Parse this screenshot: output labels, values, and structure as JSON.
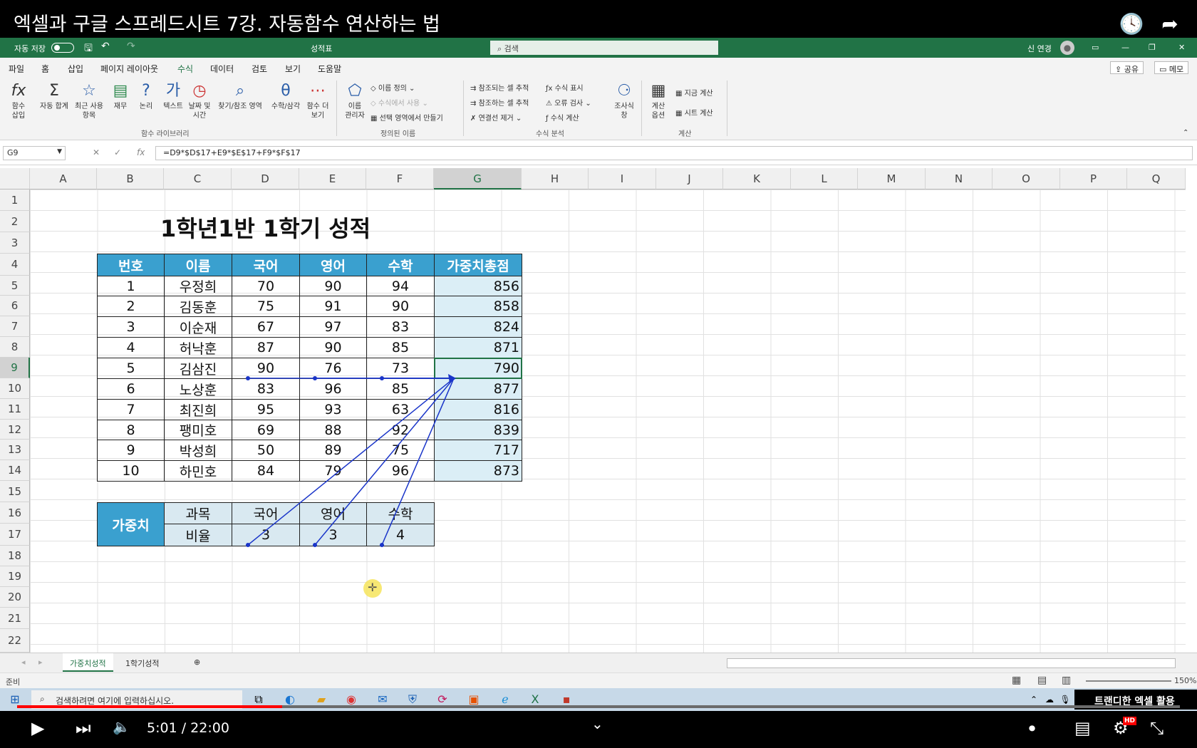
{
  "video": {
    "title": "엑셀과 구글 스프레드시트 7강. 자동함수 연산하는 법",
    "time": "5:01 / 22:00",
    "progress_pct": 22.8,
    "channel_overlay": "트랜디한 엑셀 활용",
    "hd_badge": "HD"
  },
  "titlebar": {
    "autosave": "자동 저장",
    "file_name": "성적표",
    "search_placeholder": "검색",
    "user": "신 연경"
  },
  "tabs": [
    "파일",
    "홈",
    "삽입",
    "페이지 레이아웃",
    "수식",
    "데이터",
    "검토",
    "보기",
    "도움말"
  ],
  "active_tab": "수식",
  "share": "공유",
  "memo": "메모",
  "ribbon": {
    "library": [
      "함수\n삽입",
      "자동 합계",
      "최근 사용\n항목",
      "재무",
      "논리",
      "텍스트",
      "날짜 및\n시간",
      "찾기/참조 영역",
      "수학/삼각",
      "함수 더\n보기"
    ],
    "library_group": "함수 라이브러리",
    "names_manager": "이름\n관리자",
    "names_items": [
      "이름 정의",
      "수식에서 사용",
      "선택 영역에서 만들기"
    ],
    "names_group": "정의된 이름",
    "audit_items": [
      "참조되는 셀 추적",
      "참조하는 셀 추적",
      "연결선 제거",
      "수식 표시",
      "오류 검사",
      "수식 계산"
    ],
    "watch": "조사식\n창",
    "audit_group": "수식 분석",
    "calc_options": "계산\n옵션",
    "calc_items": [
      "지금 계산",
      "시트 계산"
    ],
    "calc_group": "계산"
  },
  "namebox": "G9",
  "formula": "=D9*$D$17+E9*$E$17+F9*$F$17",
  "columns": [
    "A",
    "B",
    "C",
    "D",
    "E",
    "F",
    "G",
    "H",
    "I",
    "J",
    "K",
    "L",
    "M",
    "N",
    "O",
    "P",
    "Q"
  ],
  "rows": [
    "1",
    "2",
    "3",
    "4",
    "5",
    "6",
    "7",
    "8",
    "9",
    "10",
    "11",
    "12",
    "13",
    "14",
    "15",
    "16",
    "17",
    "18",
    "19",
    "20",
    "21",
    "22"
  ],
  "sheet_title": "1학년1반 1학기 성적",
  "table": {
    "headers": [
      "번호",
      "이름",
      "국어",
      "영어",
      "수학",
      "가중치총점"
    ],
    "rows": [
      [
        "1",
        "우정희",
        "70",
        "90",
        "94",
        "856"
      ],
      [
        "2",
        "김동훈",
        "75",
        "91",
        "90",
        "858"
      ],
      [
        "3",
        "이순재",
        "67",
        "97",
        "83",
        "824"
      ],
      [
        "4",
        "허낙훈",
        "87",
        "90",
        "85",
        "871"
      ],
      [
        "5",
        "김삼진",
        "90",
        "76",
        "73",
        "790"
      ],
      [
        "6",
        "노상훈",
        "83",
        "96",
        "85",
        "877"
      ],
      [
        "7",
        "최진희",
        "95",
        "93",
        "63",
        "816"
      ],
      [
        "8",
        "팽미호",
        "69",
        "88",
        "92",
        "839"
      ],
      [
        "9",
        "박성희",
        "50",
        "89",
        "75",
        "717"
      ],
      [
        "10",
        "하민호",
        "84",
        "79",
        "96",
        "873"
      ]
    ]
  },
  "weights": {
    "label": "가중치",
    "subject_label": "과목",
    "ratio_label": "비율",
    "subjects": [
      "국어",
      "영어",
      "수학"
    ],
    "ratios": [
      "3",
      "3",
      "4"
    ]
  },
  "sheet_tabs": [
    "가중치성적",
    "1학기성적"
  ],
  "active_sheet": "가중치성적",
  "status": "준비",
  "zoom": "150%",
  "taskbar_search": "검색하려면 여기에 입력하십시오."
}
